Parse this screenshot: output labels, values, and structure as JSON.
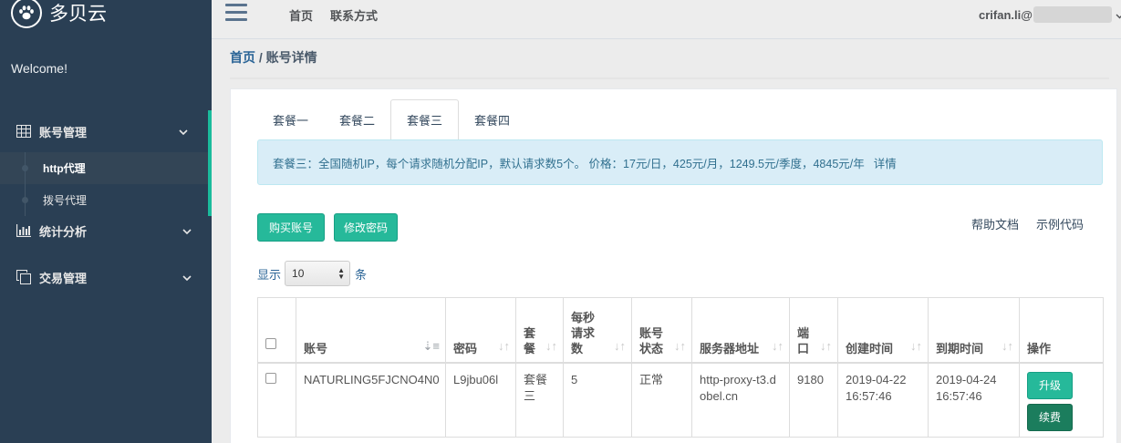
{
  "brand": {
    "name": "多贝云",
    "logo_icon": "paw-icon"
  },
  "sidebar": {
    "welcome": "Welcome!",
    "menus": [
      {
        "label": "账号管理",
        "icon": "table-icon",
        "subitems": [
          {
            "label": "http代理"
          },
          {
            "label": "拨号代理"
          }
        ]
      },
      {
        "label": "统计分析",
        "icon": "bar-chart-icon"
      },
      {
        "label": "交易管理",
        "icon": "clone-icon"
      }
    ]
  },
  "topbar": {
    "links": [
      "首页",
      "联系方式"
    ],
    "user": "crifan.li@"
  },
  "breadcrumb": {
    "home": "首页",
    "sep": " / ",
    "current": "账号详情"
  },
  "tabs": [
    "套餐一",
    "套餐二",
    "套餐三",
    "套餐四"
  ],
  "active_tab": 2,
  "alert": {
    "text": "套餐三：全国随机IP，每个请求随机分配IP，默认请求数5个。 价格：17元/日，425元/月，1249.5元/季度，4845元/年",
    "more": "详情"
  },
  "actions": {
    "buy": "购买账号",
    "change_password": "修改密码",
    "help_doc": "帮助文档",
    "sample_code": "示例代码"
  },
  "page_size": {
    "prefix": "显示",
    "value": "10",
    "suffix": "条"
  },
  "table": {
    "headers": [
      "",
      "账号",
      "密码",
      "套餐",
      "每秒请求数",
      "账号状态",
      "服务器地址",
      "端口",
      "创建时间",
      "到期时间",
      "操作"
    ],
    "rows": [
      {
        "account": "NATURLING5FJCNO4N0",
        "password": "L9jbu06l",
        "plan": "套餐三",
        "rps": "5",
        "status": "正常",
        "server": "http-proxy-t3.dobel.cn",
        "port": "9180",
        "created": "2019-04-22 16:57:46",
        "expires": "2019-04-24 16:57:46",
        "upgrade": "升级",
        "renew": "续费"
      }
    ]
  },
  "colors": {
    "sidebar": "#2a3f54",
    "accent": "#26b99a",
    "alert_bg": "#d9edf7"
  }
}
